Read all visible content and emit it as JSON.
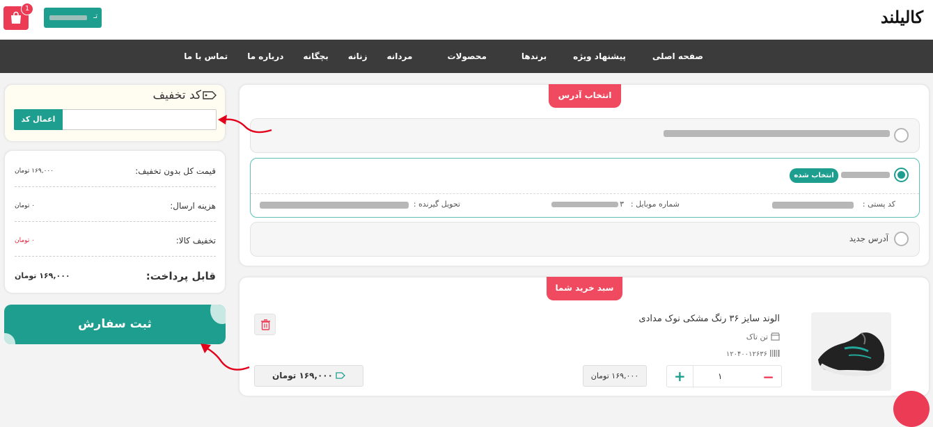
{
  "header": {
    "logo_main": "کالیلند",
    "user_button_text": "تـ",
    "cart_count": "1"
  },
  "nav": {
    "items": [
      "صفحه اصلی",
      "پیشنهاد ویژه",
      "برندها",
      "محصولات",
      "مردانه",
      "زنانه",
      "بچگانه",
      "درباره ما",
      "تماس با ما"
    ]
  },
  "discount": {
    "title": "کد تخفیف",
    "apply_label": "اعمال کد",
    "input_placeholder": ""
  },
  "summary": {
    "rows": [
      {
        "label": "قیمت کل بدون تخفیف:",
        "value": "۱۶۹,۰۰۰ تومان"
      },
      {
        "label": "هزینه ارسال:",
        "value": "۰ تومان"
      },
      {
        "label": "تخفیف کالا:",
        "value": "۰ تومان"
      },
      {
        "label": "قابل پرداخت:",
        "value": "۱۶۹,۰۰۰ تومان"
      }
    ]
  },
  "submit": {
    "label": "ثبت سفارش"
  },
  "address": {
    "section_title": "انتخاب آدرس",
    "selected_badge": "انتخاب شده",
    "postal_label": "کد پستی :",
    "mobile_label": "شماره موبایل :",
    "mobile_tail": "۳",
    "receiver_label": "تحویل گیرنده :",
    "new_address_label": "آدرس جدید"
  },
  "cart": {
    "section_title": "سبد خرید شما",
    "product_name": "الوند سایز ۳۶ رنگ مشکی نوک مدادی",
    "seller": "تن تاک",
    "code": "۱۲۰۴۰۰۱۲۶۳۶",
    "quantity": "۱",
    "unit_price": "۱۶۹,۰۰۰ تومان",
    "total_price": "۱۶۹,۰۰۰ تومان"
  },
  "colors": {
    "accent": "#1e9e8e",
    "brand_red": "#ec3c55",
    "nav_bg": "#3b3b3b"
  }
}
